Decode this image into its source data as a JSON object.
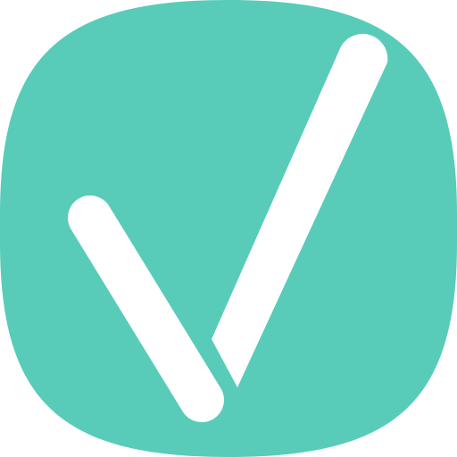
{
  "icon": {
    "name": "checkmark-app-icon",
    "glyph": "check-mark-icon",
    "background_color": "#58CCB8",
    "mark_color": "#FFFFFF",
    "page_background": "#FFFFFF"
  }
}
